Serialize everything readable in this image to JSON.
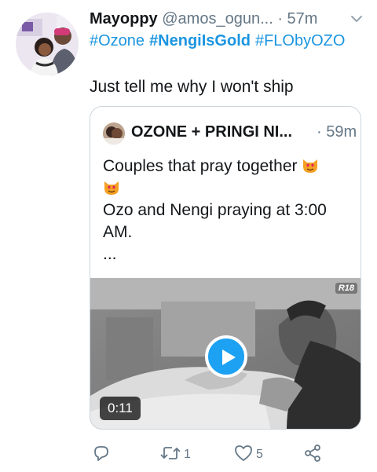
{
  "tweet": {
    "author_name": "Mayoppy",
    "handle": "@amos_ogun...",
    "separator": "·",
    "timestamp": "57m",
    "hashtags": [
      "#Ozone",
      "#NengiIsGold",
      "#FLObyOZO"
    ],
    "text": "Just tell me why I won't ship"
  },
  "quoted": {
    "author_name": "OZONE + PRINGI NI...",
    "separator": "·",
    "timestamp": "59m",
    "line1": "Couples that pray together",
    "line2": "Ozo and Nengi praying at 3:00 AM.",
    "line3": "...",
    "media": {
      "duration": "0:11",
      "watermark": "R18"
    }
  },
  "actions": {
    "retweet_count": "1",
    "like_count": "5"
  },
  "icons": [
    "caret-down-icon",
    "reply-icon",
    "retweet-icon",
    "like-icon",
    "share-icon",
    "play-icon",
    "cat-heart-eyes-emoji"
  ],
  "colors": {
    "link": "#1b95e0",
    "secondary_text": "#657786",
    "play_button": "#1da1f2",
    "border": "#ccd6dd"
  }
}
